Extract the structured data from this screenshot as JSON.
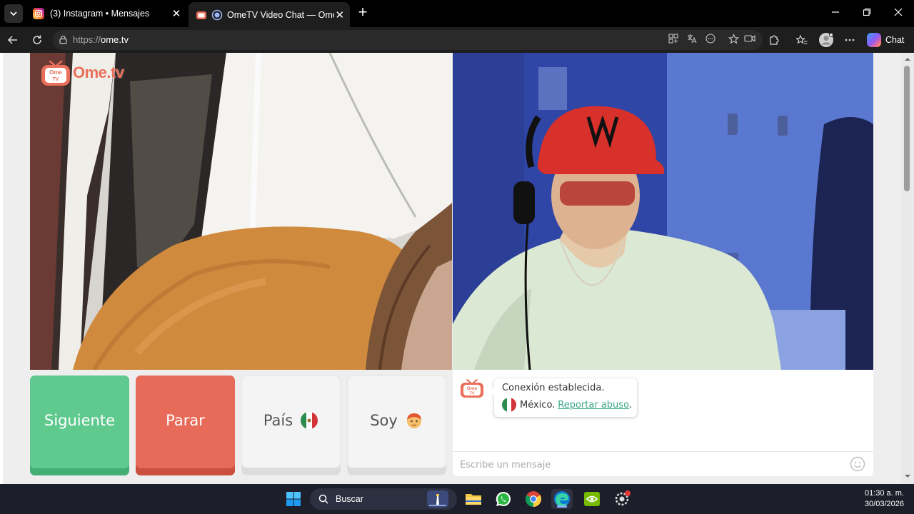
{
  "browser": {
    "tabs": [
      {
        "title": "(3) Instagram • Mensajes",
        "favicon": "instagram-icon",
        "active": false
      },
      {
        "title": "OmeTV Video Chat — Omegl",
        "favicon": "ometv-icon",
        "active": true
      }
    ],
    "new_tab": "+",
    "url_protocol": "https://",
    "url_host": "ome.tv",
    "chat_label": "Chat"
  },
  "ometv": {
    "logo_text": "Ome.tv",
    "buttons": {
      "next": "Siguiente",
      "stop": "Parar",
      "country": "País",
      "gender": "Soy"
    },
    "system_message": {
      "line1": "Conexión establecida.",
      "country": "México.",
      "report_link": "Reportar abuso",
      "trailing": "."
    },
    "chat_input_placeholder": "Escribe un mensaje"
  },
  "taskbar": {
    "search_label": "Buscar",
    "time": "01:30 a. m.",
    "date": "30/03/2026"
  },
  "colors": {
    "next_button": "#5fc98e",
    "stop_button": "#e86a58",
    "link": "#3aa889",
    "brand": "#e96f5a"
  }
}
